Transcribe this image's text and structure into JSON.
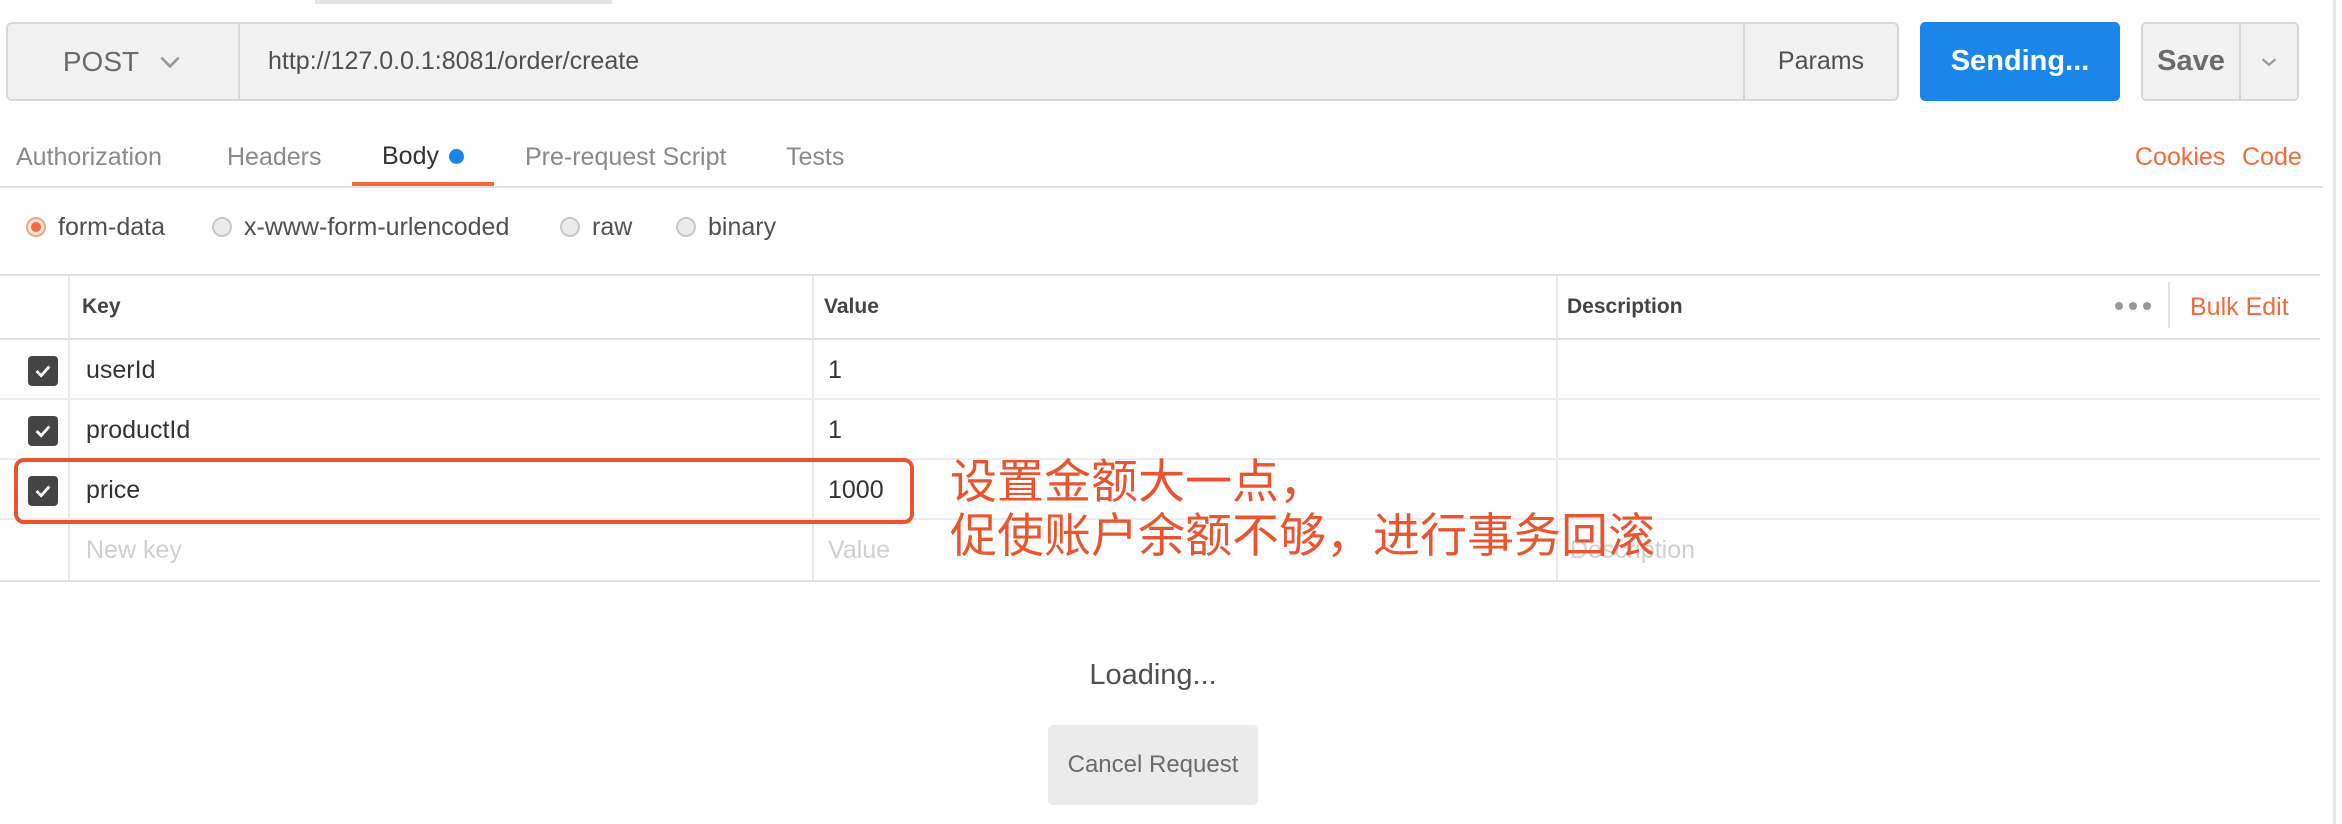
{
  "request": {
    "method": "POST",
    "url": "http://127.0.0.1:8081/order/create",
    "params_label": "Params",
    "send_label": "Sending...",
    "save_label": "Save"
  },
  "tabs": [
    {
      "label": "Authorization",
      "active": false
    },
    {
      "label": "Headers",
      "active": false
    },
    {
      "label": "Body",
      "active": true,
      "has_indicator": true
    },
    {
      "label": "Pre-request Script",
      "active": false
    },
    {
      "label": "Tests",
      "active": false
    }
  ],
  "links": {
    "cookies": "Cookies",
    "code": "Code"
  },
  "body_modes": [
    {
      "label": "form-data",
      "selected": true
    },
    {
      "label": "x-www-form-urlencoded",
      "selected": false
    },
    {
      "label": "raw",
      "selected": false
    },
    {
      "label": "binary",
      "selected": false
    }
  ],
  "table": {
    "headers": {
      "key": "Key",
      "value": "Value",
      "description": "Description"
    },
    "bulk_edit": "Bulk Edit",
    "rows": [
      {
        "checked": true,
        "key": "userId",
        "value": "1",
        "description": ""
      },
      {
        "checked": true,
        "key": "productId",
        "value": "1",
        "description": ""
      },
      {
        "checked": true,
        "key": "price",
        "value": "1000",
        "description": ""
      }
    ],
    "new_row": {
      "key_placeholder": "New key",
      "value_placeholder": "Value",
      "description_placeholder": "Description"
    }
  },
  "annotation": {
    "line1": "设置金额大一点，",
    "line2": "促使账户余额不够，进行事务回滚",
    "color": "#e8552f"
  },
  "status": {
    "loading": "Loading...",
    "cancel_label": "Cancel Request"
  },
  "colors": {
    "accent": "#f26b3a",
    "primary": "#1a86ea"
  }
}
